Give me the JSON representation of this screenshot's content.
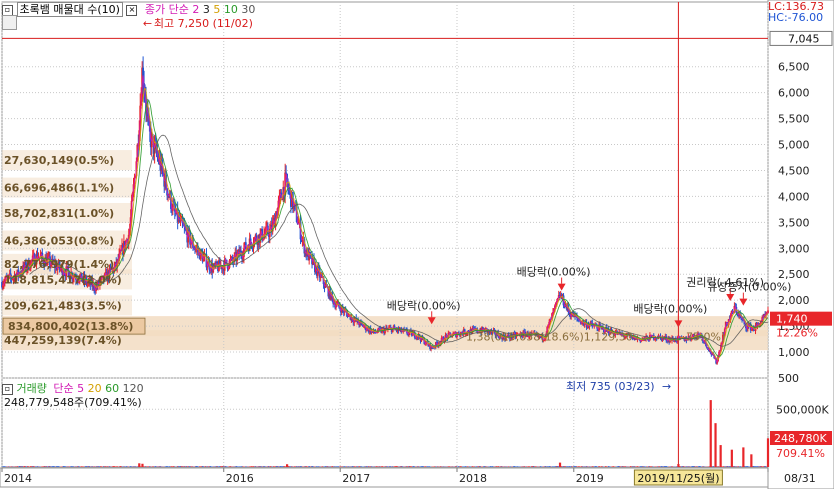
{
  "header": {
    "indicator_title": "초록뱀 매물대 수(10)",
    "ma_title": "종가 단순",
    "ma_periods": [
      "2",
      "3",
      "5",
      "10",
      "30"
    ],
    "ma_colors": [
      "#d21bb4",
      "#1d1d1d",
      "#d4a000",
      "#2a9a2a",
      "#555555"
    ]
  },
  "corner": {
    "lc": "LC:136.73",
    "hc": "HC:-76.00"
  },
  "volume_header": {
    "title": "거래량",
    "ma_title": "단순",
    "ma_periods": [
      "5",
      "20",
      "60",
      "120"
    ],
    "ma_colors": [
      "#d21bb4",
      "#d4a000",
      "#2a9a2a",
      "#555555"
    ],
    "current": "248,779,548주(709.41%)"
  },
  "colors": {
    "up": "#e8262a",
    "down": "#1f55d4",
    "profile": "#f2dcc2",
    "profile_hi": "#ecc9a2",
    "price_tag": "#e8262a",
    "crosshair": "#d81b1b",
    "grid": "#c8c8c8"
  },
  "chart_data": {
    "type": "candlestick",
    "x_axis": {
      "range": [
        "2014-02-10",
        "2020-08-31"
      ],
      "ticks": [
        {
          "date": "2014-02-10",
          "label": "2014"
        },
        {
          "date": "2016-01-04",
          "label": "2016"
        },
        {
          "date": "2017-01-02",
          "label": "2017"
        },
        {
          "date": "2018-01-02",
          "label": "2018"
        },
        {
          "date": "2019-01-02",
          "label": "2019"
        },
        {
          "date": "2020-08-31",
          "label": "08/31"
        }
      ],
      "crosshair": {
        "date": "2019-11-25",
        "label": "2019/11/25(월)"
      }
    },
    "price_axis": {
      "ylim": [
        500,
        7400
      ],
      "ticks": [
        {
          "value": 500,
          "label": "500"
        },
        {
          "value": 1000,
          "label": "1,000"
        },
        {
          "value": 1500,
          "label": "1,500"
        },
        {
          "value": 2000,
          "label": "2,000"
        },
        {
          "value": 2500,
          "label": "2,500"
        },
        {
          "value": 3000,
          "label": "3,000"
        },
        {
          "value": 3500,
          "label": "3,500"
        },
        {
          "value": 4000,
          "label": "4,000"
        },
        {
          "value": 4500,
          "label": "4,500"
        },
        {
          "value": 5000,
          "label": "5,000"
        },
        {
          "value": 5500,
          "label": "5,500"
        },
        {
          "value": 6000,
          "label": "6,000"
        },
        {
          "value": 6500,
          "label": "6,500"
        }
      ],
      "crosshair_value": 7045,
      "crosshair_label": "7,045",
      "last_value": 1740,
      "last_label": "1,740",
      "last_change_label": "12.26%"
    },
    "price_path": [
      [
        "2014-02-10",
        2350
      ],
      [
        "2014-04-01",
        2500
      ],
      [
        "2014-06-01",
        2850
      ],
      [
        "2014-08-01",
        2650
      ],
      [
        "2014-10-01",
        2450
      ],
      [
        "2014-12-01",
        2250
      ],
      [
        "2015-02-01",
        2650
      ],
      [
        "2015-03-15",
        3300
      ],
      [
        "2015-04-10",
        5000
      ],
      [
        "2015-04-25",
        6500
      ],
      [
        "2015-05-15",
        5200
      ],
      [
        "2015-06-15",
        4700
      ],
      [
        "2015-08-01",
        3700
      ],
      [
        "2015-10-01",
        3050
      ],
      [
        "2015-12-01",
        2600
      ],
      [
        "2016-02-01",
        2750
      ],
      [
        "2016-04-01",
        3150
      ],
      [
        "2016-06-01",
        3350
      ],
      [
        "2016-07-15",
        4300
      ],
      [
        "2016-08-15",
        3700
      ],
      [
        "2016-09-15",
        2950
      ],
      [
        "2016-11-01",
        2450
      ],
      [
        "2016-12-15",
        1950
      ],
      [
        "2017-02-15",
        1620
      ],
      [
        "2017-04-15",
        1380
      ],
      [
        "2017-06-15",
        1450
      ],
      [
        "2017-09-01",
        1320
      ],
      [
        "2017-10-15",
        1080
      ],
      [
        "2017-12-01",
        1300
      ],
      [
        "2018-02-01",
        1400
      ],
      [
        "2018-04-01",
        1420
      ],
      [
        "2018-06-01",
        1280
      ],
      [
        "2018-08-01",
        1350
      ],
      [
        "2018-10-01",
        1280
      ],
      [
        "2018-11-20",
        2100
      ],
      [
        "2018-12-20",
        1750
      ],
      [
        "2019-02-01",
        1560
      ],
      [
        "2019-04-01",
        1450
      ],
      [
        "2019-06-01",
        1330
      ],
      [
        "2019-08-01",
        1240
      ],
      [
        "2019-09-15",
        1300
      ],
      [
        "2019-11-01",
        1240
      ],
      [
        "2019-12-15",
        1250
      ],
      [
        "2020-02-01",
        1350
      ],
      [
        "2020-03-23",
        800
      ],
      [
        "2020-04-20",
        1500
      ],
      [
        "2020-05-20",
        1850
      ],
      [
        "2020-06-20",
        1520
      ],
      [
        "2020-07-20",
        1450
      ],
      [
        "2020-08-31",
        1740
      ]
    ],
    "volume_profile": [
      {
        "price": 1230,
        "label": "447,259,139(7.4%)"
      },
      {
        "price": 1500,
        "label": "834,800,402(13.8%)"
      },
      {
        "price": 1900,
        "label": "209,621,483(3.5%)"
      },
      {
        "price": 2400,
        "label": "118,815,417(2.0%)"
      },
      {
        "price": 2700,
        "label": "82,776,979(1.4%)"
      },
      {
        "price": 3150,
        "label": "46,386,053(0.8%)"
      },
      {
        "price": 3680,
        "label": "58,702,831(1.0%)"
      },
      {
        "price": 4170,
        "label": "66,696,486(1.1%)"
      },
      {
        "price": 4700,
        "label": "27,630,149(0.5%)"
      }
    ],
    "inline_band_label": "1,38(015,058(18.6%)1,129,30",
    "inline_band_label_2": "75.0%)",
    "annotations": [
      {
        "type": "max",
        "date": "2015-04-20",
        "value": 7250,
        "label": "최고 7,250 (11/02)"
      },
      {
        "type": "min",
        "date": "2020-03-23",
        "value": 735,
        "label": "최저 735 (03/23)"
      },
      {
        "type": "event",
        "date": "2017-10-15",
        "value": 1400,
        "label": "배당락(0.00%)"
      },
      {
        "type": "event",
        "date": "2018-11-25",
        "value": 2050,
        "label": "배당락(0.00%)"
      },
      {
        "type": "event",
        "date": "2019-11-25",
        "value": 1340,
        "label": "배당락(0.00%)"
      },
      {
        "type": "event",
        "date": "2020-05-05",
        "value": 1850,
        "label": "권리락(-4.61%)"
      },
      {
        "type": "event",
        "date": "2020-06-15",
        "value": 1760,
        "label": "유상증자(0.00%)"
      }
    ],
    "volume": {
      "ylim": [
        0,
        650000000
      ],
      "ticks": [
        {
          "value": 500000000,
          "label": "500,000K"
        }
      ],
      "last_label": "248,780K",
      "last_pct_label": "709.41%",
      "spikes": [
        {
          "date": "2015-04-15",
          "value": 32000000
        },
        {
          "date": "2015-04-25",
          "value": 28000000
        },
        {
          "date": "2016-07-20",
          "value": 24000000
        },
        {
          "date": "2018-11-20",
          "value": 38000000
        },
        {
          "date": "2019-11-25",
          "value": 26000000
        },
        {
          "date": "2020-03-05",
          "value": 580000000
        },
        {
          "date": "2020-03-20",
          "value": 380000000
        },
        {
          "date": "2020-04-05",
          "value": 190000000
        },
        {
          "date": "2020-05-10",
          "value": 150000000
        },
        {
          "date": "2020-06-15",
          "value": 170000000
        },
        {
          "date": "2020-07-10",
          "value": 110000000
        },
        {
          "date": "2020-08-31",
          "value": 248779548
        }
      ]
    }
  }
}
